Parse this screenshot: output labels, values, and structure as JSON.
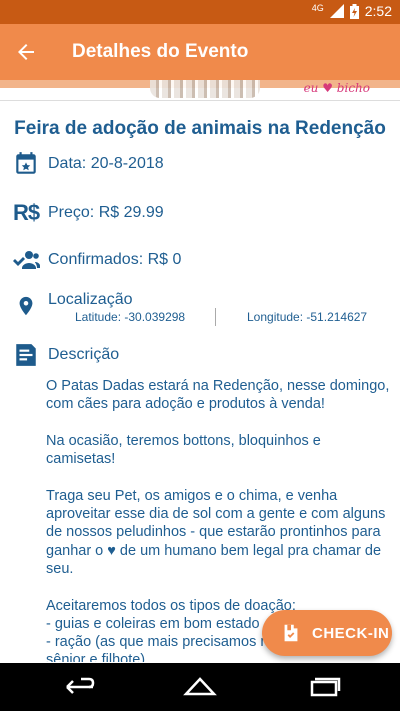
{
  "status_bar": {
    "network": "4G",
    "time": "2:52"
  },
  "toolbar": {
    "title": "Detalhes do Evento"
  },
  "banner": {
    "brand": "eu ♥ bicho"
  },
  "event": {
    "title": "Feira de adoção de animais na Redenção",
    "date": "Data: 20-8-2018",
    "price": "Preço: R$ 29.99",
    "confirmed": "Confirmados: R$ 0",
    "location_label": "Localização",
    "latitude": "Latitude: -30.039298",
    "longitude": "Longitude: -51.214627",
    "description_label": "Descrição",
    "description": "O Patas Dadas estará na Redenção, nesse domingo, com cães para adoção e produtos à venda!\n\nNa ocasião, teremos bottons, bloquinhos e camisetas!\n\nTraga seu Pet, os amigos e o chima, e venha aproveitar esse dia de sol com a gente e com alguns de nossos peludinhos - que estarão prontinhos para ganhar o ♥ de um humano bem legal pra chamar de seu.\n\nAceitaremos todos os tipos de doação:\n- guias e coleiras em bom estado\n- ração (as que mais precisamos no momento são sênior e filhote)\n- roupinhas\n- cobertas\n- remédios dentro do prazo de validade"
  },
  "fab": {
    "label": "CHECK-IN"
  },
  "colors": {
    "accent": "#f08a4b",
    "text_primary": "#1f5e91",
    "status_bar": "#c75a14"
  },
  "icons": [
    "back-arrow-icon",
    "calendar-icon",
    "currency-icon",
    "people-icon",
    "location-pin-icon",
    "notes-icon",
    "checkin-icon",
    "nav-back-icon",
    "nav-home-icon",
    "nav-recents-icon"
  ]
}
